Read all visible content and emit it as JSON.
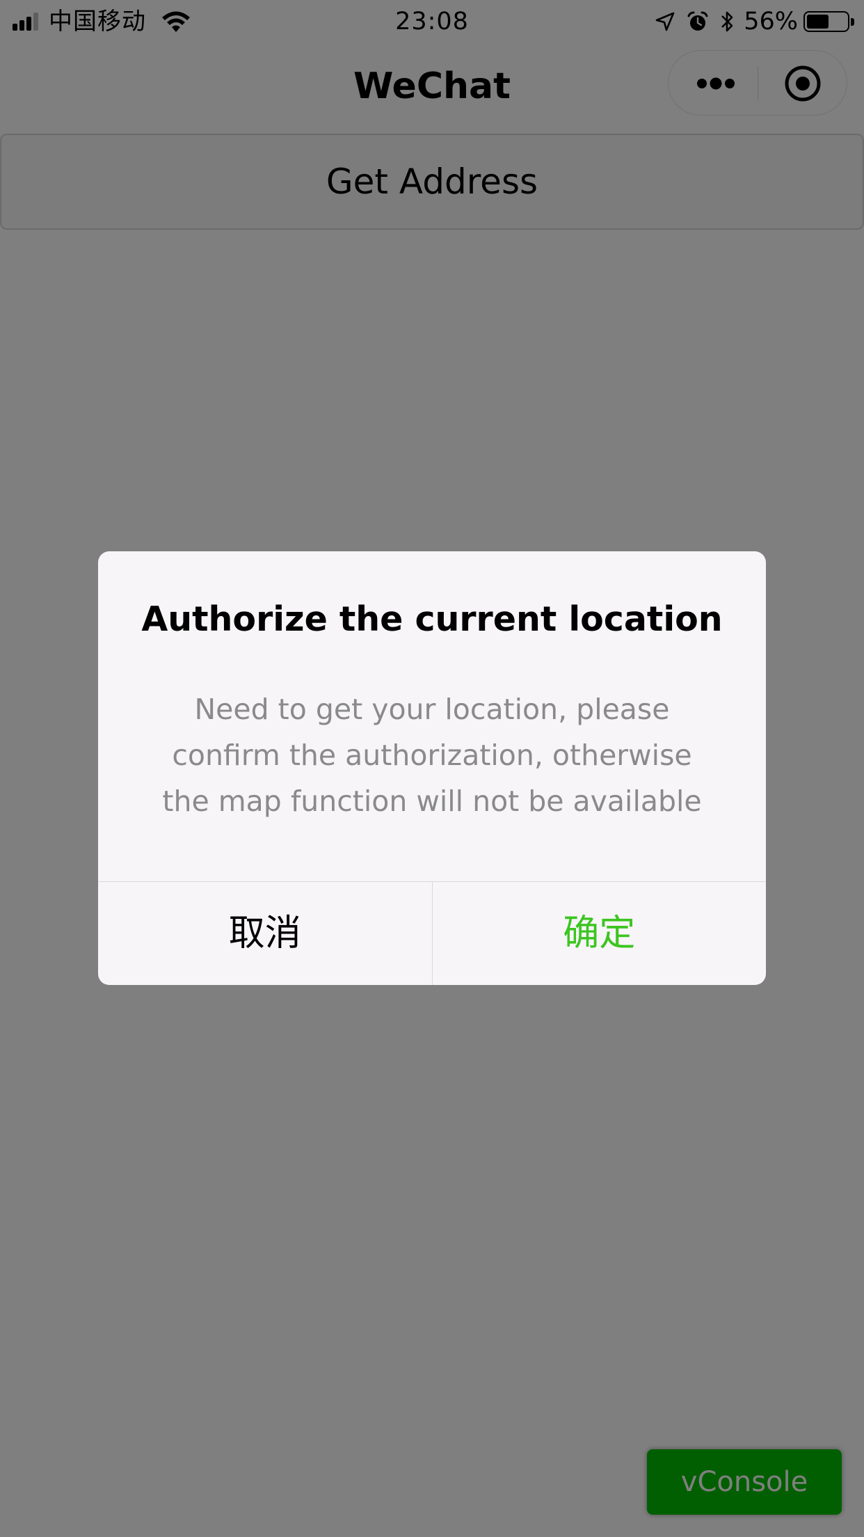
{
  "status_bar": {
    "carrier": "中国移动",
    "time": "23:08",
    "battery_percent": "56%",
    "battery_level": 0.56,
    "signal_bars_filled": 3,
    "signal_bars_total": 4,
    "icons": [
      "signal-icon",
      "wifi-icon",
      "location-arrow-icon",
      "alarm-icon",
      "bluetooth-icon",
      "battery-icon"
    ]
  },
  "nav_bar": {
    "title": "WeChat",
    "capsule": {
      "more_icon": "more-dots-icon",
      "close_icon": "close-miniprogram-icon"
    }
  },
  "page": {
    "get_address_label": "Get Address",
    "vconsole_label": "vConsole"
  },
  "dialog": {
    "title": "Authorize the current location",
    "content_lines": [
      "Need to get your location, please",
      "confirm the authorization, otherwise",
      "the map function will not be available"
    ],
    "cancel_label": "取消",
    "confirm_label": "确定"
  },
  "colors": {
    "confirm_text": "#3cc51f",
    "vconsole_bg": "#04be02",
    "mask": "rgba(0,0,0,0.5)",
    "dialog_bg": "#f7f5f8"
  }
}
